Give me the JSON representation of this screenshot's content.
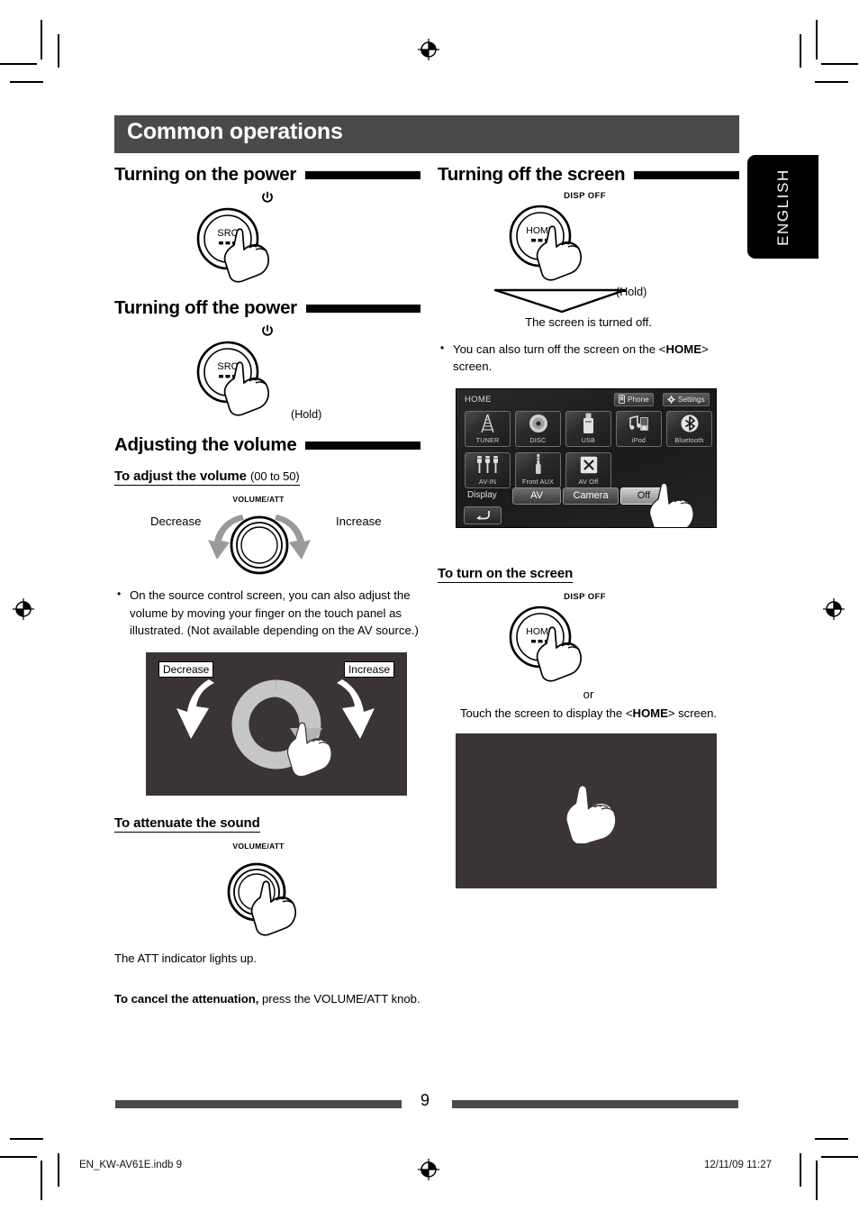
{
  "meta": {
    "chapter_title": "Common operations",
    "language_tab": "ENGLISH",
    "page_number": "9",
    "footer_left": "EN_KW-AV61E.indb   9",
    "footer_right": "12/11/09   11:27",
    "colors": {
      "chapter_bar": "#4a4a4a",
      "rule": "#000000",
      "dark_panel": "#3a3436",
      "tab_background": "#000000"
    }
  },
  "left_column": {
    "section_power_on": {
      "heading": "Turning on the power",
      "button": {
        "cap_label": "SRC",
        "power_icon": "power-icon"
      }
    },
    "section_power_off": {
      "heading": "Turning off the power",
      "button": {
        "cap_label": "SRC",
        "power_icon": "power-icon"
      },
      "hold_label": "(Hold)"
    },
    "section_volume": {
      "heading": "Adjusting the volume",
      "sub_adjust": {
        "title": "To adjust the volume",
        "range": "(00 to 50)"
      },
      "knob_label": "VOLUME/ATT",
      "decrease_label": "Decrease",
      "increase_label": "Increase",
      "note": "On the source control screen, you can also adjust the volume by moving your finger on the touch panel as illustrated. (Not available depending on the AV source.)",
      "touch_panel": {
        "decrease_tag": "Decrease",
        "increase_tag": "Increase",
        "gesture_icon": "circular-swipe-icon",
        "hand_icon": "hand-pointer-icon"
      },
      "sub_attenuate": {
        "title": "To attenuate the sound"
      },
      "attenuate_knob_label": "VOLUME/ATT",
      "attenuate_result": "The ATT indicator lights up.",
      "cancel_bold": "To cancel the attenuation,",
      "cancel_rest": " press the VOLUME/ATT knob."
    }
  },
  "right_column": {
    "section_screen_off": {
      "heading": "Turning off the screen",
      "button": {
        "cap_label": "HOME",
        "top_label": "DISP OFF"
      },
      "hold_label": "(Hold)",
      "result": "The screen is turned off.",
      "bullet_pre": "You can also turn off the screen on the <",
      "bullet_bold": "HOME",
      "bullet_post": "> screen."
    },
    "home_screen": {
      "title": "HOME",
      "top_buttons": [
        {
          "label": "Phone",
          "icon": "phone-icon"
        },
        {
          "label": "Settings",
          "icon": "gear-icon"
        }
      ],
      "tiles_row1": [
        {
          "label": "TUNER",
          "icon": "antenna-icon"
        },
        {
          "label": "DISC",
          "icon": "disc-icon"
        },
        {
          "label": "USB",
          "icon": "usb-stick-icon"
        },
        {
          "label": "iPod",
          "icon": "ipod-icon"
        },
        {
          "label": "Bluetooth",
          "icon": "bluetooth-icon"
        }
      ],
      "tiles_row2": [
        {
          "label": "AV-IN",
          "icon": "av-plugs-icon"
        },
        {
          "label": "Front AUX",
          "icon": "aux-plug-icon"
        },
        {
          "label": "AV Off",
          "icon": "x-cross-icon"
        }
      ],
      "bottom_bar": {
        "label": "Display",
        "buttons": [
          {
            "label": "AV",
            "active": false
          },
          {
            "label": "Camera",
            "active": false
          },
          {
            "label": "Off",
            "active": true
          }
        ]
      },
      "back_icon": "back-arrow-icon",
      "hand_icon": "hand-pointer-icon"
    },
    "section_screen_on": {
      "heading": "To turn on the screen",
      "button": {
        "cap_label": "HOME",
        "top_label": "DISP OFF"
      },
      "or_label": "or",
      "touch_pre": "Touch the screen to display the <",
      "touch_bold": "HOME",
      "touch_post": "> screen.",
      "black_screen": {
        "hand_icon": "hand-pointer-icon"
      }
    }
  }
}
